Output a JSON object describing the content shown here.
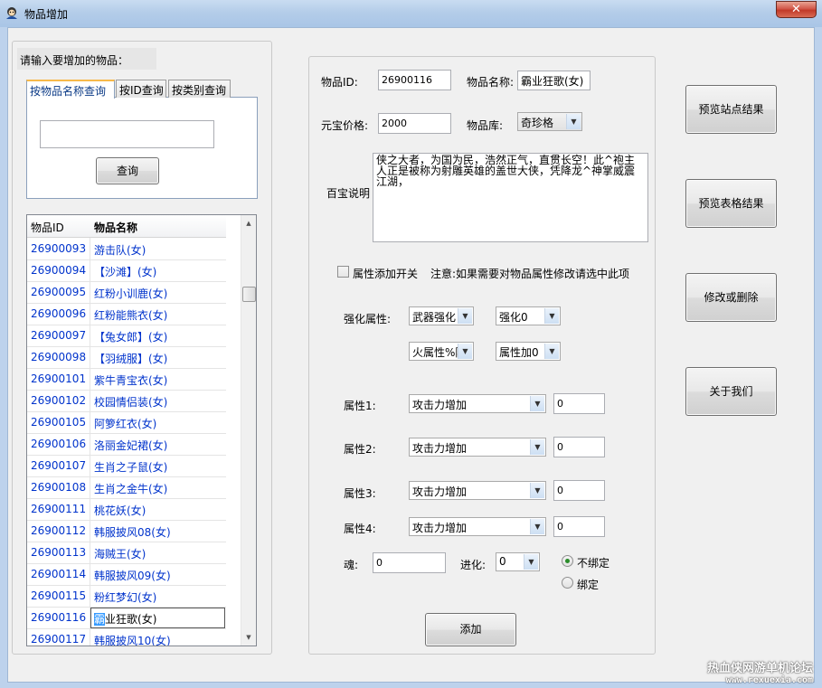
{
  "window": {
    "title": "物品增加",
    "close_label": "✕"
  },
  "search_panel": {
    "prompt": "请输入要增加的物品：",
    "tabs": [
      {
        "label": "按物品名称查询",
        "active": true
      },
      {
        "label": "按ID查询",
        "active": false
      },
      {
        "label": "按类别查询",
        "active": false
      }
    ],
    "search_value": "",
    "search_button": "查询"
  },
  "item_list": {
    "columns": [
      "物品ID",
      "物品名称"
    ],
    "rows": [
      {
        "id": "26900093",
        "name": "游击队(女)"
      },
      {
        "id": "26900094",
        "name": "【沙滩】(女)"
      },
      {
        "id": "26900095",
        "name": "红粉小训鹿(女)"
      },
      {
        "id": "26900096",
        "name": "红粉能熊衣(女)"
      },
      {
        "id": "26900097",
        "name": "【兔女郎】(女)"
      },
      {
        "id": "26900098",
        "name": "【羽绒服】(女)"
      },
      {
        "id": "26900101",
        "name": "紫牛青宝衣(女)"
      },
      {
        "id": "26900102",
        "name": "校园情侣装(女)"
      },
      {
        "id": "26900105",
        "name": "阿箩红衣(女)"
      },
      {
        "id": "26900106",
        "name": "洛丽金妃裙(女)"
      },
      {
        "id": "26900107",
        "name": "生肖之子鼠(女)"
      },
      {
        "id": "26900108",
        "name": "生肖之金牛(女)"
      },
      {
        "id": "26900111",
        "name": "桃花妖(女)"
      },
      {
        "id": "26900112",
        "name": "韩服披风08(女)"
      },
      {
        "id": "26900113",
        "name": "海贼王(女)"
      },
      {
        "id": "26900114",
        "name": "韩服披风09(女)"
      },
      {
        "id": "26900115",
        "name": "粉红梦幻(女)"
      },
      {
        "id": "26900116",
        "name": "霸业狂歌(女)",
        "selected": true
      },
      {
        "id": "26900117",
        "name": "韩服披风10(女)"
      }
    ]
  },
  "form": {
    "item_id_label": "物品ID:",
    "item_id_value": "26900116",
    "item_name_label": "物品名称:",
    "item_name_value": "霸业狂歌(女)",
    "price_label": "元宝价格:",
    "price_value": "2000",
    "library_label": "物品库:",
    "library_value": "奇珍格",
    "desc_label": "百宝说明",
    "desc_value": "侠之大者，为国为民，浩然正气，直贯长空！此^袍主人正是被称为射雕英雄的盖世大侠，凭降龙^神掌威震江湖，",
    "attr_switch_label": "属性添加开关",
    "attr_note": "注意:如果需要对物品属性修改请选中此项",
    "enhance_label": "强化属性:",
    "enhance_type": "武器强化",
    "enhance_level": "强化0",
    "element_type": "火属性%防",
    "element_level": "属性加0",
    "attributes": [
      {
        "label": "属性1:",
        "type": "攻击力增加",
        "value": "0"
      },
      {
        "label": "属性2:",
        "type": "攻击力增加",
        "value": "0"
      },
      {
        "label": "属性3:",
        "type": "攻击力增加",
        "value": "0"
      },
      {
        "label": "属性4:",
        "type": "攻击力增加",
        "value": "0"
      }
    ],
    "soul_label": "魂:",
    "soul_value": "0",
    "evolve_label": "进化:",
    "evolve_value": "0",
    "bind_options": [
      {
        "label": "不绑定",
        "checked": true
      },
      {
        "label": "绑定",
        "checked": false
      }
    ],
    "add_button": "添加"
  },
  "side_buttons": {
    "preview_site": "预览站点结果",
    "preview_table": "预览表格结果",
    "modify_delete": "修改或删除",
    "about": "关于我们"
  },
  "watermark": {
    "line1": "热血侠网游单机论坛",
    "line2": "www.rexuexia.com"
  }
}
